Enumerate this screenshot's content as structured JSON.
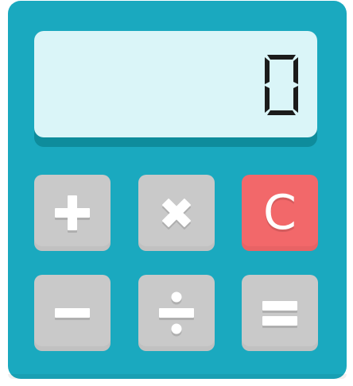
{
  "display": {
    "value": "0"
  },
  "colors": {
    "body": "#1aa9bf",
    "screen": "#daf5f8",
    "screen_shadow": "#0e8c9c",
    "key": "#c9c9c9",
    "clear_key": "#f2686a",
    "glyph": "#ffffff",
    "digit": "#1b1b1b"
  },
  "keys": [
    {
      "icon": "plus-icon"
    },
    {
      "icon": "multiply-icon"
    },
    {
      "icon": "clear-icon",
      "label": "C"
    },
    {
      "icon": "minus-icon"
    },
    {
      "icon": "divide-icon"
    },
    {
      "icon": "equals-icon"
    }
  ]
}
